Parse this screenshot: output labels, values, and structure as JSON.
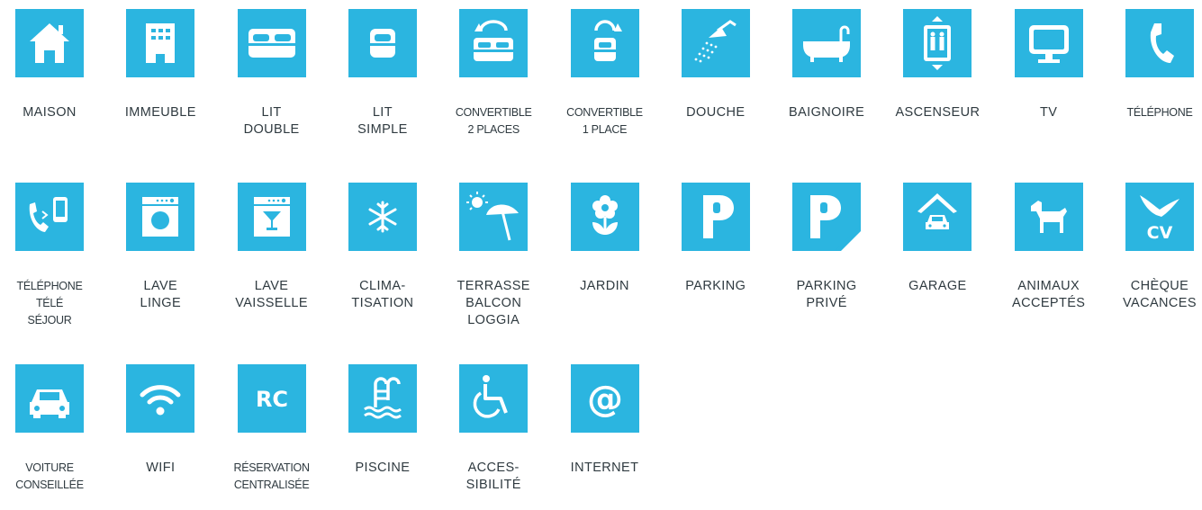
{
  "colors": {
    "tile": "#2bb5e0",
    "icon": "#ffffff",
    "text": "#2f3a40"
  },
  "rows": [
    [
      {
        "icon": "house-icon",
        "label": [
          "MAISON"
        ]
      },
      {
        "icon": "building-icon",
        "label": [
          "IMMEUBLE"
        ]
      },
      {
        "icon": "double-bed-icon",
        "label": [
          "LIT",
          "DOUBLE"
        ]
      },
      {
        "icon": "single-bed-icon",
        "label": [
          "LIT",
          "SIMPLE"
        ]
      },
      {
        "icon": "convertible-double-icon",
        "label": [
          "CONVERTIBLE",
          "2 PLACES"
        ]
      },
      {
        "icon": "convertible-single-icon",
        "label": [
          "CONVERTIBLE",
          "1 PLACE"
        ]
      },
      {
        "icon": "shower-icon",
        "label": [
          "DOUCHE"
        ]
      },
      {
        "icon": "bathtub-icon",
        "label": [
          "BAIGNOIRE"
        ]
      },
      {
        "icon": "elevator-icon",
        "label": [
          "ASCENSEUR"
        ]
      },
      {
        "icon": "tv-icon",
        "label": [
          "TV"
        ]
      },
      {
        "icon": "phone-icon",
        "label": [
          "TÉLÉPHONE"
        ]
      }
    ],
    [
      {
        "icon": "phone-tele-sejour-icon",
        "label": [
          "TÉLÉPHONE",
          "TÉLÉ",
          "SÉJOUR"
        ]
      },
      {
        "icon": "washing-machine-icon",
        "label": [
          "LAVE",
          "LINGE"
        ]
      },
      {
        "icon": "dishwasher-icon",
        "label": [
          "LAVE",
          "VAISSELLE"
        ]
      },
      {
        "icon": "snowflake-icon",
        "label": [
          "CLIMA-",
          "TISATION"
        ]
      },
      {
        "icon": "terrace-icon",
        "label": [
          "TERRASSE",
          "BALCON",
          "LOGGIA"
        ]
      },
      {
        "icon": "flower-icon",
        "label": [
          "JARDIN"
        ]
      },
      {
        "icon": "parking-icon",
        "label": [
          "PARKING"
        ]
      },
      {
        "icon": "private-parking-icon",
        "label": [
          "PARKING",
          "PRIVÉ"
        ]
      },
      {
        "icon": "garage-icon",
        "label": [
          "GARAGE"
        ]
      },
      {
        "icon": "dog-icon",
        "label": [
          "ANIMAUX",
          "ACCEPTÉS"
        ]
      },
      {
        "icon": "cheque-vacances-icon",
        "label": [
          "CHÈQUE",
          "VACANCES"
        ]
      }
    ],
    [
      {
        "icon": "car-icon",
        "label": [
          "VOITURE",
          "CONSEILLÉE"
        ]
      },
      {
        "icon": "wifi-icon",
        "label": [
          "WIFI"
        ]
      },
      {
        "icon": "rc-icon",
        "label": [
          "RÉSERVATION",
          "CENTRALISÉE"
        ]
      },
      {
        "icon": "pool-icon",
        "label": [
          "PISCINE"
        ]
      },
      {
        "icon": "accessibility-icon",
        "label": [
          "ACCES-",
          "SIBILITÉ"
        ]
      },
      {
        "icon": "at-sign-icon",
        "label": [
          "INTERNET"
        ]
      }
    ]
  ],
  "tile_text": {
    "rc": "RC",
    "cv": "CV",
    "at": "@"
  }
}
